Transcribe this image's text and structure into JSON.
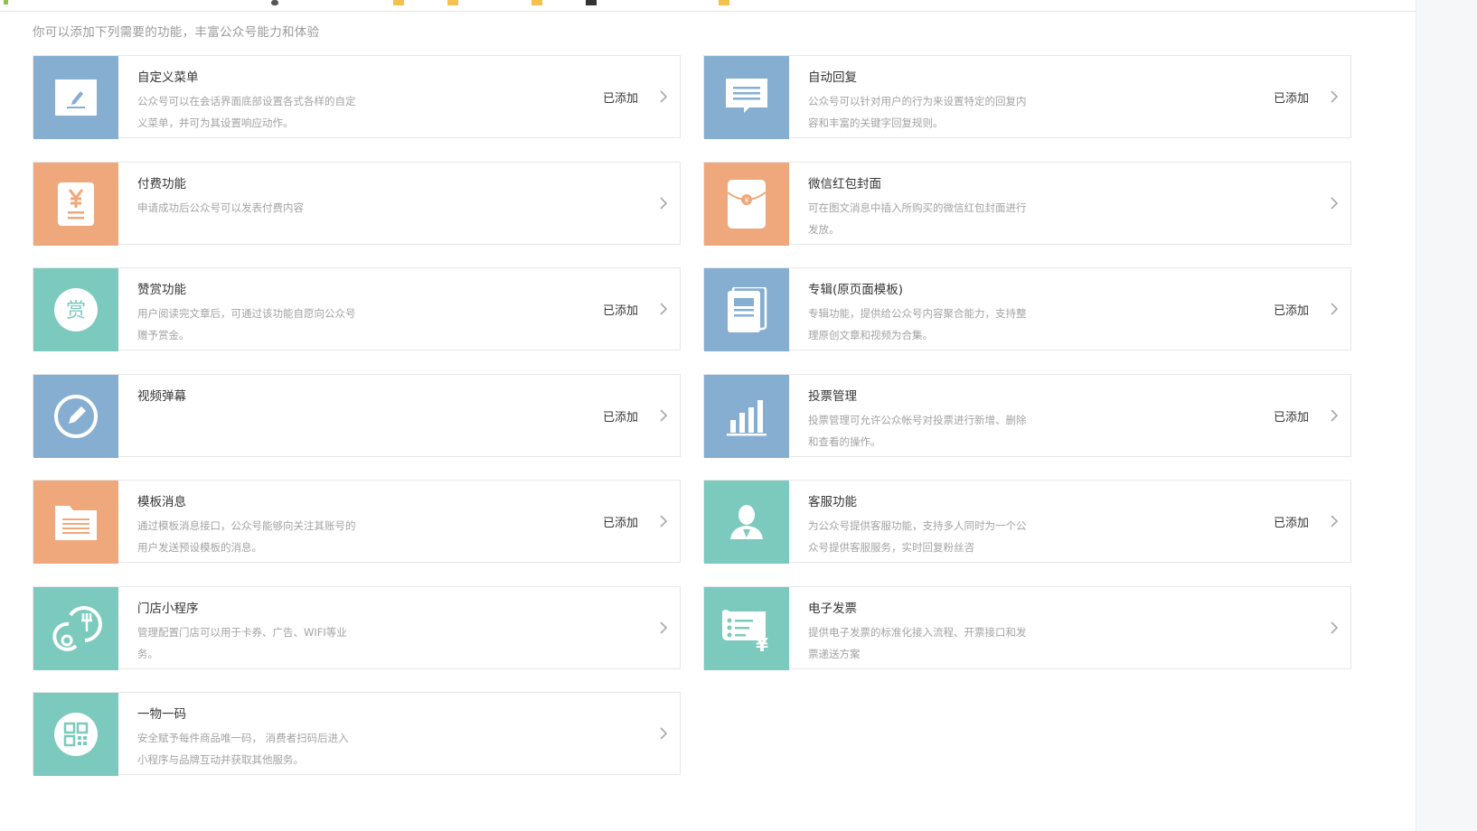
{
  "intro": "你可以添加下列需要的功能，丰富公众号能力和体验",
  "colors": {
    "blue": "#85aed1",
    "orange": "#efa87b",
    "teal": "#7ccabd"
  },
  "cards": [
    {
      "title": "自定义菜单",
      "desc": "公众号可以在会话界面底部设置各式各样的自定义菜单，并可为其设置响应动作。",
      "status": "已添加",
      "icon": "edit-icon",
      "color": "blue"
    },
    {
      "title": "自动回复",
      "desc": "公众号可以针对用户的行为来设置特定的回复内容和丰富的关键字回复规则。",
      "status": "已添加",
      "icon": "message-icon",
      "color": "blue"
    },
    {
      "title": "付费功能",
      "desc": "申请成功后公众号可以发表付费内容",
      "status": "",
      "icon": "yen-receipt-icon",
      "color": "orange"
    },
    {
      "title": "微信红包封面",
      "desc": "可在图文消息中插入所购买的微信红包封面进行发放。",
      "status": "",
      "icon": "red-envelope-icon",
      "color": "orange"
    },
    {
      "title": "赞赏功能",
      "desc": "用户阅读完文章后，可通过该功能自愿向公众号赠予赏金。",
      "status": "已添加",
      "icon": "reward-icon",
      "color": "teal",
      "icon_text": "赏"
    },
    {
      "title": "专辑(原页面模板)",
      "desc": "专辑功能，提供给公众号内容聚合能力，支持整理原创文章和视频为合集。",
      "status": "已添加",
      "icon": "album-icon",
      "color": "blue"
    },
    {
      "title": "视频弹幕",
      "desc": "",
      "status": "已添加",
      "icon": "pencil-circle-icon",
      "color": "blue"
    },
    {
      "title": "投票管理",
      "desc": "投票管理可允许公众帐号对投票进行新增、删除和查看的操作。",
      "status": "已添加",
      "icon": "bar-chart-icon",
      "color": "blue"
    },
    {
      "title": "模板消息",
      "desc": "通过模板消息接口，公众号能够向关注其账号的用户发送预设模板的消息。",
      "status": "已添加",
      "icon": "folder-icon",
      "color": "orange"
    },
    {
      "title": "客服功能",
      "desc": "为公众号提供客服功能，支持多人同时为一个公众号提供客服服务，实时回复粉丝咨",
      "status": "已添加",
      "icon": "support-agent-icon",
      "color": "teal"
    },
    {
      "title": "门店小程序",
      "desc": "管理配置门店可以用于卡券、广告、WIFI等业务。",
      "status": "",
      "icon": "store-icon",
      "color": "teal"
    },
    {
      "title": "电子发票",
      "desc": "提供电子发票的标准化接入流程、开票接口和发票递送方案",
      "status": "",
      "icon": "invoice-icon",
      "color": "teal"
    },
    {
      "title": "一物一码",
      "desc": "安全赋予每件商品唯一码， 消费者扫码后进入小程序与品牌互动并获取其他服务。",
      "status": "",
      "icon": "qr-code-icon",
      "color": "teal"
    }
  ]
}
